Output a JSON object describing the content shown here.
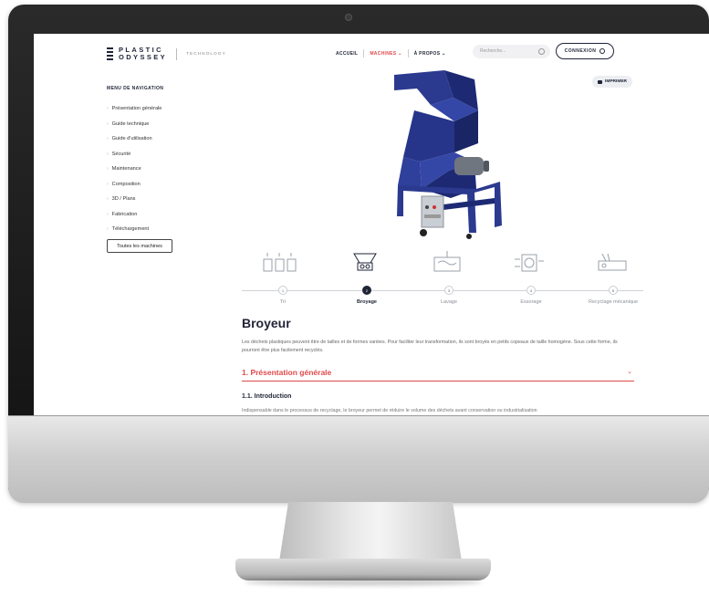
{
  "header": {
    "logo_line1": "PLASTIC",
    "logo_line2": "ODYSSEY",
    "logo_sub": "TECHNOLOGY",
    "nav": [
      {
        "label": "ACCUEIL"
      },
      {
        "label": "MACHINES ⌄"
      },
      {
        "label": "À PROPOS ⌄"
      }
    ],
    "search_placeholder": "Recherche...",
    "login_label": "CONNEXION"
  },
  "print_label": "IMPRIMER",
  "sidebar": {
    "title": "MENU DE NAVIGATION",
    "items": [
      "Présentation générale",
      "Guide technique",
      "Guide d'utilisation",
      "Sécurité",
      "Maintenance",
      "Composition",
      "3D / Plans",
      "Fabrication",
      "Téléchargement"
    ],
    "all_machines": "Toutes les machines"
  },
  "steps": [
    {
      "num": "1",
      "label": "Tri",
      "active": false
    },
    {
      "num": "2",
      "label": "Broyage",
      "active": true
    },
    {
      "num": "3",
      "label": "Lavage",
      "active": false
    },
    {
      "num": "4",
      "label": "Essorage",
      "active": false
    },
    {
      "num": "5",
      "label": "Recyclage mécanique",
      "active": false
    }
  ],
  "content": {
    "title": "Broyeur",
    "intro": "Les déchets plastiques peuvent être de tailles et de formes variées. Pour faciliter leur transformation, ils sont broyés en petits copeaux de taille homogène. Sous cette forme, ils pourront être plus facilement recyclés.",
    "section_title": "1. Présentation générale",
    "subsection_title": "1.1. Introduction",
    "cut_text": "Indispensable dans le processus de recyclage, le broyeur permet de réduire le volume des déchets avant conservation ou industrialisation"
  },
  "colors": {
    "accent": "#e0494b",
    "navy": "#1f2437",
    "machine_blue": "#2b3a8f"
  }
}
